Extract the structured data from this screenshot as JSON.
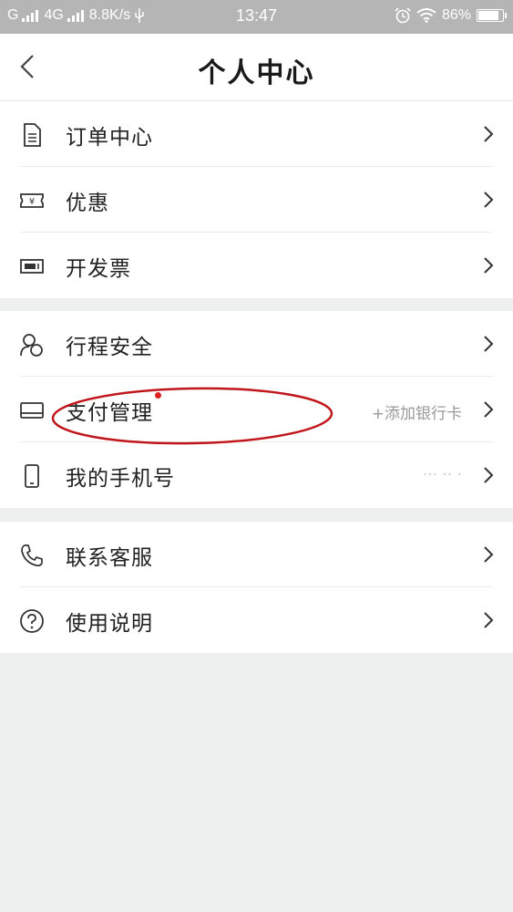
{
  "status_bar": {
    "carrier1": "G",
    "network": "4G",
    "speed": "8.8K/s",
    "time": "13:47",
    "battery": "86%",
    "battery_level": 0.86
  },
  "header": {
    "title": "个人中心"
  },
  "groups": [
    {
      "items": [
        {
          "label": "订单中心",
          "icon": "document-icon"
        },
        {
          "label": "优惠",
          "icon": "coupon-icon"
        },
        {
          "label": "开发票",
          "icon": "invoice-icon"
        }
      ]
    },
    {
      "items": [
        {
          "label": "行程安全",
          "icon": "safety-icon"
        },
        {
          "label": "支付管理",
          "icon": "card-icon",
          "extra": "+添加银行卡"
        },
        {
          "label": "我的手机号",
          "icon": "phone-icon",
          "extra": "··· ·· ·"
        }
      ]
    },
    {
      "items": [
        {
          "label": "联系客服",
          "icon": "customer-service-icon"
        },
        {
          "label": "使用说明",
          "icon": "help-icon"
        }
      ]
    }
  ],
  "colors": {
    "accent_red": "#c0151a",
    "page_bg": "#eef0f0"
  }
}
